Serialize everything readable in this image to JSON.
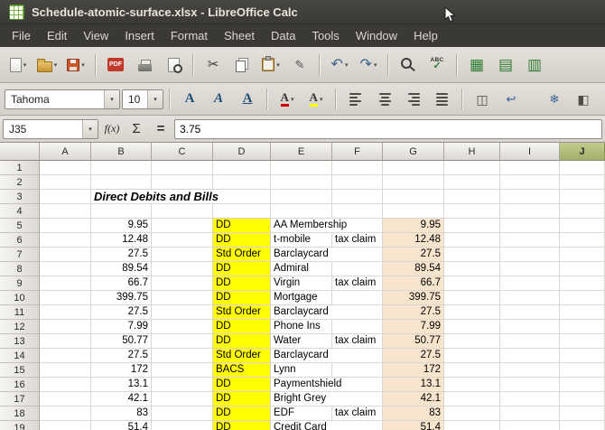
{
  "window": {
    "title": "Schedule-atomic-surface.xlsx - LibreOffice Calc"
  },
  "menu_bar": {
    "items": [
      "File",
      "Edit",
      "View",
      "Insert",
      "Format",
      "Sheet",
      "Data",
      "Tools",
      "Window",
      "Help"
    ]
  },
  "standard_toolbar": {
    "buttons": [
      {
        "name": "new-document",
        "icon": "doc",
        "dropdown": true
      },
      {
        "name": "open-file",
        "icon": "folder",
        "dropdown": true
      },
      {
        "name": "save",
        "icon": "save",
        "dropdown": true
      },
      {
        "separator": true
      },
      {
        "name": "export-pdf",
        "icon": "pdf"
      },
      {
        "name": "print",
        "icon": "print"
      },
      {
        "name": "print-preview",
        "icon": "preview"
      },
      {
        "separator": true
      },
      {
        "name": "cut",
        "icon": "cut"
      },
      {
        "name": "copy",
        "icon": "copy"
      },
      {
        "name": "paste",
        "icon": "paste",
        "dropdown": true
      },
      {
        "name": "clone-formatting",
        "icon": "brush"
      },
      {
        "separator": true
      },
      {
        "name": "undo",
        "icon": "undo",
        "dropdown": true
      },
      {
        "name": "redo",
        "icon": "redo",
        "dropdown": true
      },
      {
        "separator": true
      },
      {
        "name": "find-and-replace",
        "icon": "mag"
      },
      {
        "name": "spelling",
        "icon": "abc"
      },
      {
        "separator": true
      },
      {
        "name": "insert-table",
        "icon": "grid"
      },
      {
        "name": "insert-row",
        "icon": "gridrow"
      },
      {
        "name": "insert-column",
        "icon": "gridcol"
      }
    ]
  },
  "formatting_toolbar": {
    "font_name": "Tahoma",
    "font_size": "10",
    "buttons": [
      {
        "name": "bold",
        "icon": "A-bold"
      },
      {
        "name": "italic",
        "icon": "A-italic"
      },
      {
        "name": "underline",
        "icon": "A-under"
      },
      {
        "separator": true
      },
      {
        "name": "font-color",
        "icon": "A-color",
        "dropdown": true
      },
      {
        "name": "highlighting-color",
        "icon": "A-high",
        "dropdown": true
      },
      {
        "separator": true
      },
      {
        "name": "align-left",
        "icon": "align-left"
      },
      {
        "name": "align-center",
        "icon": "align-center"
      },
      {
        "name": "align-right",
        "icon": "align-right"
      },
      {
        "name": "justified",
        "icon": "align-justify"
      },
      {
        "separator": true
      },
      {
        "name": "merge-cells",
        "icon": "merge"
      },
      {
        "name": "wrap-text",
        "icon": "wrap"
      }
    ],
    "right_buttons": [
      {
        "name": "freeze-rows-and-columns",
        "icon": "freeze"
      },
      {
        "name": "split-window",
        "icon": "split"
      }
    ]
  },
  "formula_bar": {
    "cell_reference": "J35",
    "fx_label": "f(x)",
    "sum_label": "Σ",
    "equals_label": "=",
    "content": "3.75"
  },
  "grid": {
    "column_headers": [
      "A",
      "B",
      "C",
      "D",
      "E",
      "F",
      "G",
      "H",
      "I"
    ],
    "selected_column_partial": "J",
    "visible_row_count": 19,
    "title_row": {
      "row": 3,
      "text": "Direct Debits and Bills"
    },
    "data_rows": [
      {
        "row": 5,
        "amount": "9.95",
        "method": "DD",
        "payee": "AA Membership",
        "note": "",
        "amount2": "9.95"
      },
      {
        "row": 6,
        "amount": "12.48",
        "method": "DD",
        "payee": "t-mobile",
        "note": "tax claim",
        "amount2": "12.48"
      },
      {
        "row": 7,
        "amount": "27.5",
        "method": "Std Order",
        "payee": "Barclaycard",
        "note": "",
        "amount2": "27.5"
      },
      {
        "row": 8,
        "amount": "89.54",
        "method": "DD",
        "payee": "Admiral",
        "note": "",
        "amount2": "89.54"
      },
      {
        "row": 9,
        "amount": "66.7",
        "method": "DD",
        "payee": "Virgin",
        "note": "tax claim",
        "amount2": "66.7"
      },
      {
        "row": 10,
        "amount": "399.75",
        "method": "DD",
        "payee": "Mortgage",
        "note": "",
        "amount2": "399.75"
      },
      {
        "row": 11,
        "amount": "27.5",
        "method": "Std Order",
        "payee": "Barclaycard",
        "note": "",
        "amount2": "27.5"
      },
      {
        "row": 12,
        "amount": "7.99",
        "method": "DD",
        "payee": "Phone Ins",
        "note": "",
        "amount2": "7.99"
      },
      {
        "row": 13,
        "amount": "50.77",
        "method": "DD",
        "payee": "Water",
        "note": "tax claim",
        "amount2": "50.77"
      },
      {
        "row": 14,
        "amount": "27.5",
        "method": "Std Order",
        "payee": "Barclaycard",
        "note": "",
        "amount2": "27.5"
      },
      {
        "row": 15,
        "amount": "172",
        "method": "BACS",
        "payee": "Lynn",
        "note": "",
        "amount2": "172"
      },
      {
        "row": 16,
        "amount": "13.1",
        "method": "DD",
        "payee": "Paymentshield",
        "note": "",
        "amount2": "13.1"
      },
      {
        "row": 17,
        "amount": "42.1",
        "method": "DD",
        "payee": "Bright Grey",
        "note": "",
        "amount2": "42.1"
      },
      {
        "row": 18,
        "amount": "83",
        "method": "DD",
        "payee": "EDF",
        "note": "tax claim",
        "amount2": "83"
      },
      {
        "row": 19,
        "amount": "51.4",
        "method": "DD",
        "payee": "Credit Card",
        "note": "",
        "amount2": "51.4"
      }
    ],
    "colors": {
      "method_bg": "#ffff00",
      "amount2_bg": "#f7e4cd",
      "selected_header": "#aebb74"
    }
  }
}
